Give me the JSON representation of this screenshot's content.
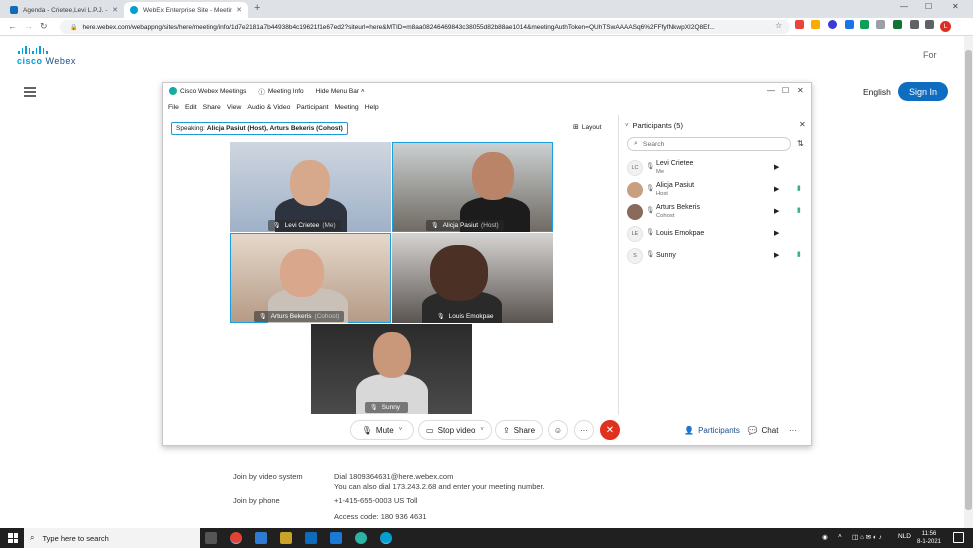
{
  "browser": {
    "tabs": [
      {
        "title": "Agenda - Crietee,Levi L.P.J. - Outlook",
        "active": false
      },
      {
        "title": "WebEx Enterprise Site - Meeting",
        "active": true
      }
    ],
    "url": "here.webex.com/webappng/sites/here/meeting/info/1d7e2181a7b44938b4c19621f1e67ed2?siteurl=here&MTID=m8aa08246469843c38055d82b88ae1014&meetingAuthToken=QUhTSwAAAASq6%2FFfyfNkwpXI2Q8Ef...",
    "profile_initial": "L"
  },
  "page": {
    "logo_brand": "cisco",
    "logo_product": "Webex",
    "for_link": "For",
    "language": "English",
    "sign_in": "Sign In",
    "join_video_label": "Join by video system",
    "join_video_value": "Dial 1809364631@here.webex.com",
    "join_video_alt": "You can also dial 173.243.2.68 and enter your meeting number.",
    "join_phone_label": "Join by phone",
    "join_phone_value": "+1-415-655-0003 US Toll",
    "access_code": "Access code: 180 936 4631"
  },
  "meeting": {
    "app_title": "Cisco Webex Meetings",
    "meeting_info": "Meeting Info",
    "hide_menu": "Hide Menu Bar",
    "menu": [
      "File",
      "Edit",
      "Share",
      "View",
      "Audio & Video",
      "Participant",
      "Meeting",
      "Help"
    ],
    "speaking_label": "Speaking:",
    "speaking_names": "Alicja Pasiut (Host), Arturs Bekeris (Cohost)",
    "layout_label": "Layout",
    "tiles": [
      {
        "name": "Levi Crietee",
        "role": "(Me)"
      },
      {
        "name": "Alicja Pasiut",
        "role": "(Host)"
      },
      {
        "name": "Arturs Bekeris",
        "role": "(Cohost)"
      },
      {
        "name": "Louis Emokpae",
        "role": ""
      },
      {
        "name": "Sunny",
        "role": ""
      }
    ],
    "controls": {
      "mute": "Mute",
      "stop_video": "Stop video",
      "share": "Share",
      "participants": "Participants",
      "chat": "Chat"
    }
  },
  "participants": {
    "header": "Participants (5)",
    "search_placeholder": "Search",
    "list": [
      {
        "initials": "LC",
        "name": "Levi Crietee",
        "role": "Me"
      },
      {
        "initials": "",
        "name": "Alicja Pasiut",
        "role": "Host"
      },
      {
        "initials": "",
        "name": "Arturs Bekeris",
        "role": "Cohost"
      },
      {
        "initials": "LE",
        "name": "Louis Emokpae",
        "role": ""
      },
      {
        "initials": "S",
        "name": "Sunny",
        "role": ""
      }
    ]
  },
  "taskbar": {
    "search_placeholder": "Type here to search",
    "lang": "NLD",
    "time": "11:56",
    "date": "8-1-2021"
  },
  "colors": {
    "accent": "#1aa0dc",
    "sign_in": "#0f6dc1",
    "end_call": "#e0301e",
    "active_speaker": "#36b37e"
  }
}
